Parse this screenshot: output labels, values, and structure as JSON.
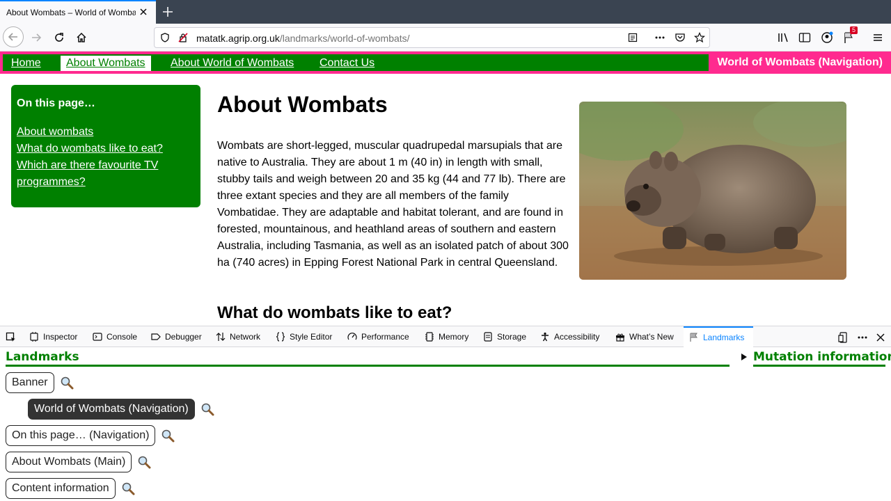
{
  "browser": {
    "tab_title": "About Wombats – World of Wombats",
    "url_host": "matatk.agrip.org.uk",
    "url_path": "/landmarks/world-of-wombats/",
    "notification_count": "5"
  },
  "site": {
    "nav_links": [
      "Home",
      "About Wombats",
      "About World of Wombats",
      "Contact Us"
    ],
    "nav_title": "World of Wombats (Navigation)",
    "toc_heading": "On this page…",
    "toc_links": [
      "About wombats",
      "What do wombats like to eat?",
      "Which are there favourite TV programmes?"
    ],
    "heading": "About Wombats",
    "paragraph": "Wombats are short-legged, muscular quadrupedal marsupials that are native to Australia. They are about 1 m (40 in) in length with small, stubby tails and weigh between 20 and 35 kg (44 and 77 lb). There are three extant species and they are all members of the family Vombatidae. They are adaptable and habitat tolerant, and are found in forested, mountainous, and heathland areas of southern and eastern Australia, including Tasmania, as well as an isolated patch of about 300 ha (740 acres) in Epping Forest National Park in central Queensland.",
    "subheading": "What do wombats like to eat?"
  },
  "devtools": {
    "tabs": [
      "Inspector",
      "Console",
      "Debugger",
      "Network",
      "Style Editor",
      "Performance",
      "Memory",
      "Storage",
      "Accessibility",
      "What’s New",
      "Landmarks"
    ],
    "active_tab": "Landmarks",
    "landmarks_heading": "Landmarks",
    "mutation_heading": "Mutation information",
    "landmarks": [
      "Banner",
      "World of Wombats (Navigation)",
      "On this page… (Navigation)",
      "About Wombats (Main)",
      "Content information"
    ]
  },
  "colors": {
    "site_green": "#008000",
    "site_pink": "#ff2a8f",
    "devtools_accent": "#0a84ff"
  }
}
